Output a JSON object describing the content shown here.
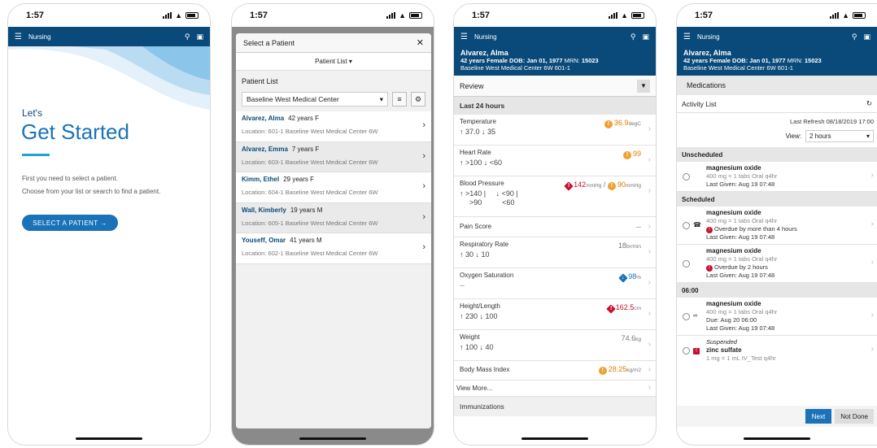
{
  "status": {
    "time": "1:57"
  },
  "nav": {
    "title": "Nursing"
  },
  "icons": {
    "menu": "hamburger-icon",
    "search": "search-icon",
    "camera": "camera-icon",
    "chevron": "chevron-right-icon",
    "close": "close-icon",
    "sort": "sort-icon",
    "gear": "gear-icon"
  },
  "colors": {
    "brand": "#0a4a7a",
    "accent": "#1a73b8",
    "warn": "#e07c00",
    "critical": "#c8102e"
  },
  "screen1": {
    "lets": "Let's",
    "title": "Get Started",
    "instr1": "First you need to select a patient.",
    "instr2": "Choose from your list or search to find a patient.",
    "button": "SELECT A PATIENT →"
  },
  "screen2": {
    "modal_title": "Select a Patient",
    "close": "✕",
    "list_dropdown": "Patient List ▾",
    "list_title": "Patient List",
    "location_filter": "Baseline West Medical Center",
    "patients": [
      {
        "name": "Alvarez, Alma",
        "info": "42 years F",
        "location": "Location: 601-1  Baseline West Medical Center 6W"
      },
      {
        "name": "Alvarez, Emma",
        "info": "7 years F",
        "location": "Location: 603-1  Baseline West Medical Center 6W"
      },
      {
        "name": "Kimm, Ethel",
        "info": "29 years F",
        "location": "Location: 604-1  Baseline West Medical Center 6W"
      },
      {
        "name": "Wall, Kimberly",
        "info": "19 years M",
        "location": "Location: 605-1  Baseline West Medical Center 6W"
      },
      {
        "name": "Youseff, Omar",
        "info": "41 years M",
        "location": "Location: 602-1  Baseline West Medical Center 6W"
      }
    ]
  },
  "patient_header": {
    "name": "Alvarez, Alma",
    "demo_prefix": "42 years Female ",
    "dob_label": "DOB:",
    "dob": " Jan 01, 1977 ",
    "mrn_label": "MRN:",
    "mrn": " 15023",
    "location": "Baseline West Medical Center 6W 601-1"
  },
  "screen3": {
    "review": "Review",
    "section": "Last 24 hours",
    "vitals": [
      {
        "label": "Temperature",
        "range": "↑ 37.0 ↓ 35",
        "value": "36.9",
        "unit": "degC"
      },
      {
        "label": "Heart Rate",
        "range": "↑ >100 ↓ <60",
        "value": "99",
        "unit": ""
      },
      {
        "label": "Blood Pressure",
        "range1": "↑ >140 |     ↓ <90 |",
        "range2": ">90          <60",
        "value": "142",
        "unit": "mmHg",
        "value2": "90",
        "unit2": "mmHg",
        "sep": " / "
      },
      {
        "label": "Pain Score",
        "value": "--"
      },
      {
        "label": "Respiratory Rate",
        "range": "↑ 30 ↓ 10",
        "value": "18",
        "unit": "br/min"
      },
      {
        "label": "Oxygen Saturation",
        "range": "--",
        "value": "98",
        "unit": "%"
      },
      {
        "label": "Height/Length",
        "range": "↑ 230 ↓ 100",
        "value": "162.5",
        "unit": "cm"
      },
      {
        "label": "Weight",
        "range": "↑ 100 ↓ 40",
        "value": "74.6",
        "unit": "kg"
      },
      {
        "label": "Body Mass Index",
        "value": "28.25",
        "unit": "kg/m2"
      }
    ],
    "view_more": "View More...",
    "immunizations": "Immunizations"
  },
  "screen4": {
    "subheader": "Medications",
    "activity_list": "Activity List",
    "last_refresh": "Last Refresh 08/18/2019 17:00",
    "view_label": "View:",
    "view_value": "2 hours",
    "sections": {
      "unscheduled": "Unscheduled",
      "scheduled": "Scheduled",
      "time0600": "06:00"
    },
    "meds": [
      {
        "name": "magnesium oxide",
        "dose": "400 mg = 1 tabs Oral q4hr",
        "last": "Last Given: Aug 19 07:48"
      },
      {
        "name": "magnesium oxide",
        "dose": "400 mg = 1 tabs Oral q4hr",
        "alert": "Overdue by more than 4 hours",
        "last": "Last Given: Aug 19 07:48"
      },
      {
        "name": "magnesium oxide",
        "dose": "400 mg = 1 tabs Oral q4hr",
        "alert": "Overdue by 2 hours",
        "last": "Last Given: Aug 19 07:48"
      },
      {
        "name": "magnesium oxide",
        "dose": "400 mg = 1 tabs Oral q4hr",
        "due": "Due: Aug 20 06:00",
        "last": "Last Given: Aug 19 07:48"
      },
      {
        "status": "Suspended",
        "name": "zinc sulfate",
        "dose": "1 mg = 1 mL IV_Test q4hr"
      }
    ],
    "btn_next": "Next",
    "btn_notdone": "Not Done"
  }
}
